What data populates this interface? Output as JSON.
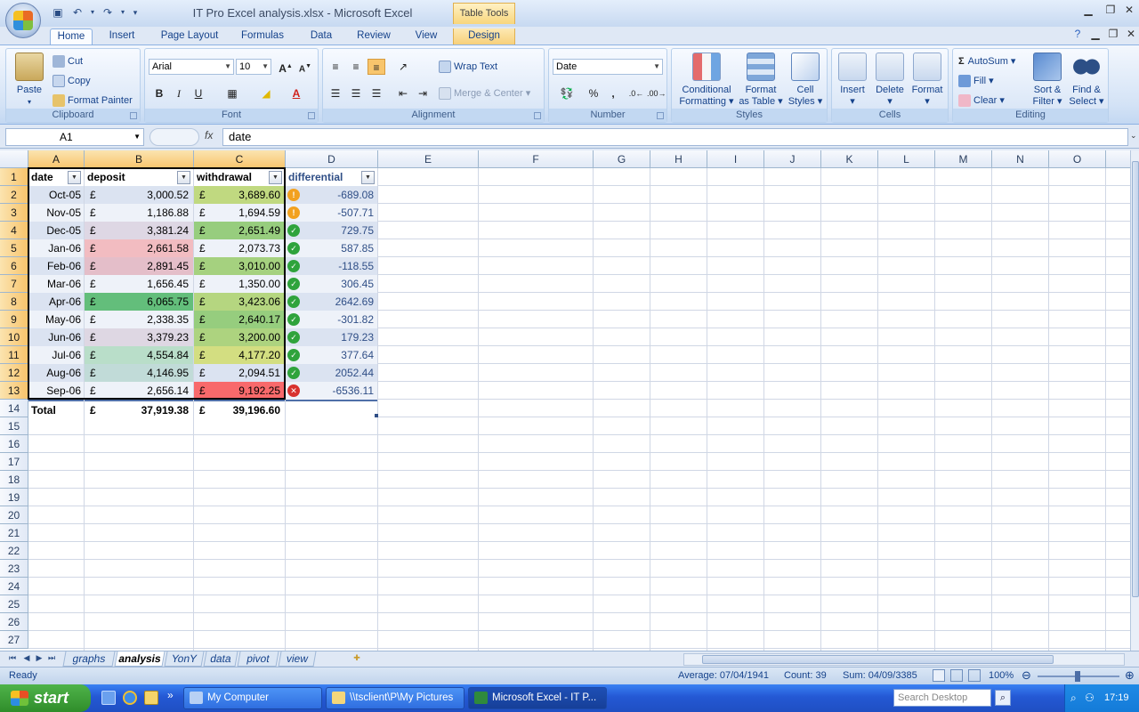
{
  "window": {
    "title": "IT Pro Excel analysis.xlsx - Microsoft Excel",
    "contextual_tab_group": "Table Tools"
  },
  "ribbon_tabs": [
    "Home",
    "Insert",
    "Page Layout",
    "Formulas",
    "Data",
    "Review",
    "View",
    "Design"
  ],
  "ribbon": {
    "clipboard": {
      "paste": "Paste",
      "cut": "Cut",
      "copy": "Copy",
      "format_painter": "Format Painter",
      "label": "Clipboard"
    },
    "font": {
      "name": "Arial",
      "size": "10",
      "bold": "B",
      "italic": "I",
      "underline": "U",
      "label": "Font"
    },
    "alignment": {
      "wrap_text": "Wrap Text",
      "merge_center": "Merge & Center",
      "label": "Alignment"
    },
    "number": {
      "format": "Date",
      "percent": "%",
      "comma": ",",
      "label": "Number"
    },
    "styles": {
      "conditional_1": "Conditional",
      "conditional_2": "Formatting",
      "format_table_1": "Format",
      "format_table_2": "as Table",
      "cell_styles_1": "Cell",
      "cell_styles_2": "Styles",
      "label": "Styles"
    },
    "cells": {
      "insert": "Insert",
      "delete": "Delete",
      "format": "Format",
      "label": "Cells"
    },
    "editing": {
      "autosum": "AutoSum",
      "fill": "Fill",
      "clear": "Clear",
      "sort_1": "Sort &",
      "sort_2": "Filter",
      "find_1": "Find &",
      "find_2": "Select",
      "label": "Editing"
    }
  },
  "formula_bar": {
    "name_box": "A1",
    "fx": "fx",
    "content": "date"
  },
  "columns": [
    "A",
    "B",
    "C",
    "D",
    "E",
    "F",
    "G",
    "H",
    "I",
    "J",
    "K",
    "L",
    "M",
    "N",
    "O"
  ],
  "rows": [
    "1",
    "2",
    "3",
    "4",
    "5",
    "6",
    "7",
    "8",
    "9",
    "10",
    "11",
    "12",
    "13",
    "14",
    "15",
    "16",
    "17",
    "18",
    "19",
    "20",
    "21",
    "22",
    "23",
    "24",
    "25",
    "26",
    "27"
  ],
  "table": {
    "headers": [
      "date",
      "deposit",
      "withdrawal",
      "differential"
    ],
    "currency_symbol": "£",
    "rows": [
      {
        "date": "Oct-05",
        "deposit": "3,000.52",
        "withdrawal": "3,689.60",
        "differential": "-689.08",
        "icon": "warning-icon"
      },
      {
        "date": "Nov-05",
        "deposit": "1,186.88",
        "withdrawal": "1,694.59",
        "differential": "-507.71",
        "icon": "warning-icon"
      },
      {
        "date": "Dec-05",
        "deposit": "3,381.24",
        "withdrawal": "2,651.49",
        "differential": "729.75",
        "icon": "check-icon"
      },
      {
        "date": "Jan-06",
        "deposit": "2,661.58",
        "withdrawal": "2,073.73",
        "differential": "587.85",
        "icon": "check-icon"
      },
      {
        "date": "Feb-06",
        "deposit": "2,891.45",
        "withdrawal": "3,010.00",
        "differential": "-118.55",
        "icon": "check-icon"
      },
      {
        "date": "Mar-06",
        "deposit": "1,656.45",
        "withdrawal": "1,350.00",
        "differential": "306.45",
        "icon": "check-icon"
      },
      {
        "date": "Apr-06",
        "deposit": "6,065.75",
        "withdrawal": "3,423.06",
        "differential": "2642.69",
        "icon": "check-icon"
      },
      {
        "date": "May-06",
        "deposit": "2,338.35",
        "withdrawal": "2,640.17",
        "differential": "-301.82",
        "icon": "check-icon"
      },
      {
        "date": "Jun-06",
        "deposit": "3,379.23",
        "withdrawal": "3,200.00",
        "differential": "179.23",
        "icon": "check-icon"
      },
      {
        "date": "Jul-06",
        "deposit": "4,554.84",
        "withdrawal": "4,177.20",
        "differential": "377.64",
        "icon": "check-icon"
      },
      {
        "date": "Aug-06",
        "deposit": "4,146.95",
        "withdrawal": "2,094.51",
        "differential": "2052.44",
        "icon": "check-icon"
      },
      {
        "date": "Sep-06",
        "deposit": "2,656.14",
        "withdrawal": "9,192.25",
        "differential": "-6536.11",
        "icon": "cross-icon"
      }
    ],
    "total_label": "Total",
    "total_deposit": "37,919.38",
    "total_withdrawal": "39,196.60"
  },
  "color_scale": {
    "low": "#f8696b",
    "mid": "#ffeb84",
    "high": "#63be7b"
  },
  "sheet_tabs": [
    "graphs",
    "analysis",
    "YonY",
    "data",
    "pivot",
    "view"
  ],
  "active_sheet": "analysis",
  "status_bar": {
    "mode": "Ready",
    "average": "Average: 07/04/1941",
    "count": "Count: 39",
    "sum": "Sum: 04/09/3385",
    "zoom": "100%"
  },
  "taskbar": {
    "start": "start",
    "items": [
      "My Computer",
      "\\\\tsclient\\P\\My Pictures",
      "Microsoft Excel - IT P..."
    ],
    "search_placeholder": "Search Desktop",
    "clock": "17:19"
  }
}
